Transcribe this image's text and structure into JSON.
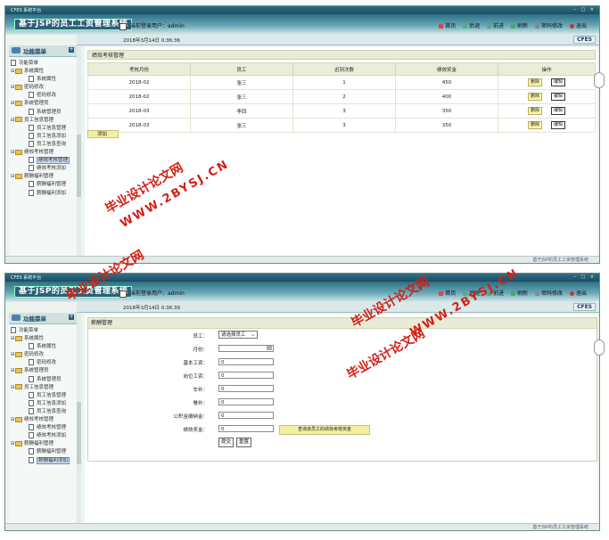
{
  "app": {
    "window_title": "CFES 系统平台",
    "system_name": "基于JSP的员工工资管理系统",
    "current_user_label": "当前登录用户：admin",
    "cfes_badge": "CFES",
    "status_text": "基于JSP的员工工资管理系统"
  },
  "toolbar": {
    "home": "首页",
    "back": "后退",
    "forward": "前进",
    "refresh": "刷新",
    "password": "密码修改",
    "logout": "退出"
  },
  "sidebar": {
    "title": "功能菜单",
    "subtitle": "FUNCTION MENU",
    "root": "功能菜单",
    "groups": [
      {
        "label": "系统属性",
        "items": [
          "系统属性"
        ]
      },
      {
        "label": "密码修改",
        "items": [
          "密码修改"
        ]
      },
      {
        "label": "系统管理员",
        "items": [
          "系统管理员"
        ]
      },
      {
        "label": "员工信息管理",
        "items": [
          "员工信息管理",
          "员工信息添加",
          "员工信息查询"
        ]
      },
      {
        "label": "绩效考核管理",
        "items": [
          "绩效考核管理",
          "绩效考核添加"
        ]
      },
      {
        "label": "薪酬福利管理",
        "items": [
          "薪酬福利管理",
          "薪酬福利添加"
        ]
      }
    ]
  },
  "screen1": {
    "date": "2018年3月14日  0:36:36",
    "panel_title": "绩效考核管理",
    "columns": [
      "考核月份",
      "员工",
      "迟到次数",
      "绩效奖金",
      "操作"
    ],
    "rows": [
      [
        "2018-02",
        "张三",
        "1",
        "450"
      ],
      [
        "2018-02",
        "张三",
        "2",
        "400"
      ],
      [
        "2018-03",
        "李四",
        "3",
        "350"
      ],
      [
        "2018-03",
        "张三",
        "3",
        "350"
      ]
    ],
    "delete_label": "删除",
    "edit_label": "编辑",
    "add_label": "添加",
    "selected_menu": "绩效考核管理"
  },
  "screen2": {
    "date": "2018年3月14日  0:36:39",
    "panel_title": "薪酬管理",
    "fields": [
      {
        "label": "员工：",
        "value": "请选择员工",
        "type": "select"
      },
      {
        "label": "月份：",
        "value": "",
        "type": "date"
      },
      {
        "label": "基本工资：",
        "value": "0",
        "type": "text"
      },
      {
        "label": "岗位工资：",
        "value": "0",
        "type": "text"
      },
      {
        "label": "车补：",
        "value": "0",
        "type": "text"
      },
      {
        "label": "餐补：",
        "value": "0",
        "type": "text"
      },
      {
        "label": "公积金缴纳金：",
        "value": "0",
        "type": "text"
      },
      {
        "label": "绩效奖金：",
        "value": "0",
        "type": "text"
      }
    ],
    "query_button": "查询该员工的绩效考核奖金",
    "submit_label": "提交",
    "reset_label": "重置",
    "selected_menu": "薪酬福利添加"
  },
  "watermarks": {
    "line1": "毕业设计论文网",
    "line2": "WWW.2BYSJ.CN",
    "color": "#d32016"
  }
}
